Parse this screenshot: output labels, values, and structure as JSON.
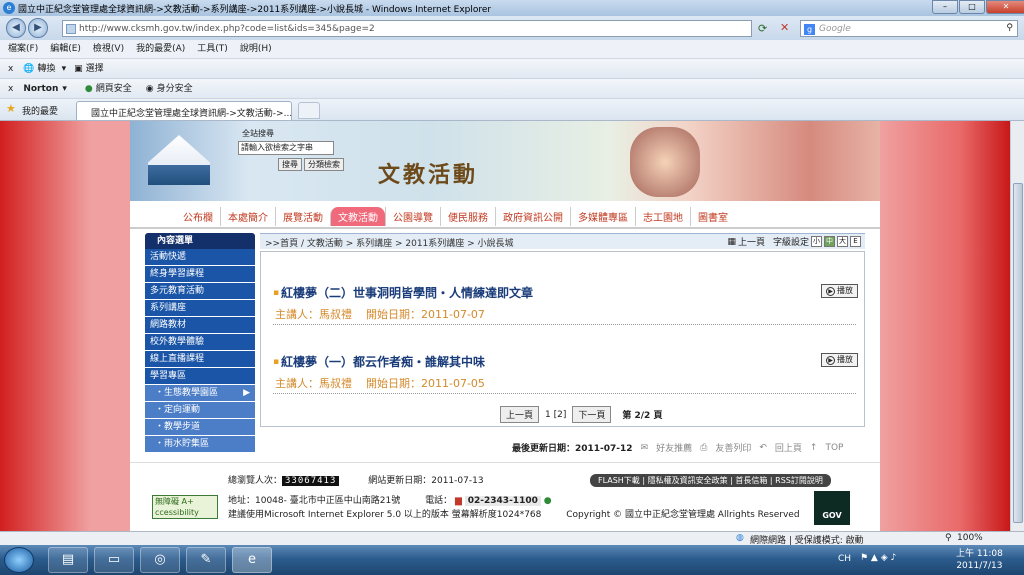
{
  "window": {
    "title": "國立中正紀念堂管理處全球資訊網->文教活動->系列講座->2011系列講座->小說長城 - Windows Internet Explorer",
    "min": "–",
    "max": "□",
    "close": "✕"
  },
  "addressbar": {
    "url": "http://www.cksmh.gov.tw/index.php?code=list&ids=345&page=2",
    "search_placeholder": "Google"
  },
  "menu": [
    "檔案(F)",
    "編輯(E)",
    "檢視(V)",
    "我的最愛(A)",
    "工具(T)",
    "說明(H)"
  ],
  "toolbar1": {
    "close": "x",
    "convert": "轉換",
    "select": "選擇"
  },
  "toolbar2": {
    "close": "x",
    "norton": "Norton",
    "web_safe": "網頁安全",
    "id_safe": "身分安全"
  },
  "favorites": {
    "label": "我的最愛",
    "tab_title": "國立中正紀念堂管理處全球資訊網->文教活動->..."
  },
  "banner": {
    "search_label": "全站搜尋",
    "keyword_placeholder": "請輸入欲檢索之字串",
    "search_btn": "搜尋",
    "cat_search_btn": "分類檢索",
    "title": "文教活動"
  },
  "nav": [
    "公布欄",
    "本處簡介",
    "展覽活動",
    "文教活動",
    "公園導覽",
    "便民服務",
    "政府資訊公開",
    "多媒體專區",
    "志工園地",
    "圖書室"
  ],
  "sidebar": {
    "header": "內容選單",
    "items": [
      "活動快遞",
      "終身學習課程",
      "多元教育活動",
      "系列講座",
      "網路教材",
      "校外教學體驗",
      "線上直播課程",
      "學習專區"
    ],
    "sub_items": [
      "・生態教學園區",
      "・定向運動",
      "・教學步道",
      "・雨水貯集區"
    ]
  },
  "breadcrumb": {
    "text": ">>首頁 / 文教活動 > 系列講座 > 2011系列講座 > 小說長城",
    "prev": "上一頁",
    "font_label": "字級設定",
    "font_sizes": [
      "小",
      "中",
      "大",
      "E"
    ]
  },
  "entries": [
    {
      "title": "紅樓夢（二）世事洞明皆學問・人情練達即文章",
      "speaker": "主講人：馬叔禮",
      "date": "開始日期：2011-07-07",
      "play": "播放"
    },
    {
      "title": "紅樓夢（一）都云作者痴・誰解其中味",
      "speaker": "主講人：馬叔禮",
      "date": "開始日期：2011-07-05",
      "play": "播放"
    }
  ],
  "pager": {
    "prev": "上一頁",
    "pages": "1 [2]",
    "next": "下一頁",
    "summary": "第 2/2 頁"
  },
  "update": {
    "label": "最後更新日期：2011-07-12",
    "recommend": "好友推薦",
    "print": "友善列印",
    "back": "回上頁",
    "top": "TOP"
  },
  "footer": {
    "visitors_label": "總瀏覽人次：",
    "visitors": "33067413",
    "site_update": "網站更新日期：2011-07-13",
    "links": "FLASH下載 | 隱私權及資訊安全政策 | 首長信箱 | RSS訂閱說明",
    "address": "地址：10048- 臺北市中正區中山南路21號",
    "phone_label": "電話：",
    "phone": "02-2343-1100",
    "browser_note": "建議使用Microsoft Internet Explorer 5.0 以上的版本 螢幕解析度1024*768",
    "copyright": "Copyright © 國立中正紀念堂管理處 Allrights Reserved",
    "accessibility": "無障礙 A+ ccessibility",
    "gov": "GOV"
  },
  "statusbar": {
    "zone": "網際網路 | 受保護模式: 啟動",
    "zoom": "100%"
  },
  "taskbar": {
    "lang": "CH",
    "time": "上午 11:08",
    "date": "2011/7/13"
  }
}
